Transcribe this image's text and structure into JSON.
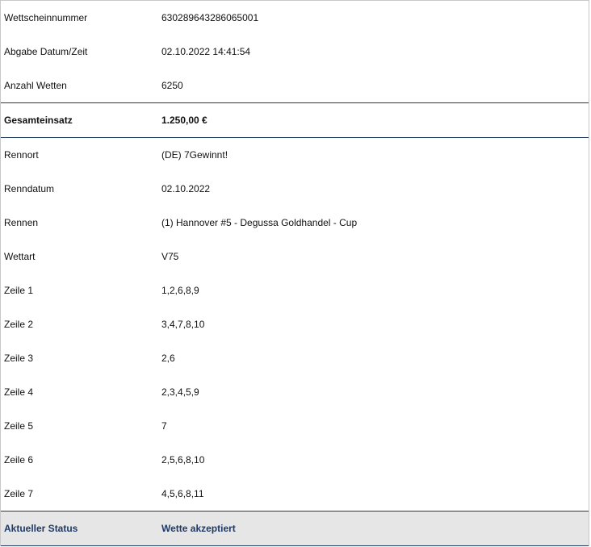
{
  "header_rows": [
    {
      "label": "Wettscheinnummer",
      "value": "630289643286065001"
    },
    {
      "label": "Abgabe Datum/Zeit",
      "value": "02.10.2022 14:41:54"
    },
    {
      "label": "Anzahl Wetten",
      "value": "6250"
    }
  ],
  "total": {
    "label": "Gesamteinsatz",
    "value": "1.250,00 €"
  },
  "detail_rows": [
    {
      "label": "Rennort",
      "value": "(DE) 7Gewinnt!"
    },
    {
      "label": "Renndatum",
      "value": "02.10.2022"
    },
    {
      "label": "Rennen",
      "value": "(1) Hannover #5 - Degussa Goldhandel - Cup"
    },
    {
      "label": "Wettart",
      "value": "V75"
    },
    {
      "label": "Zeile 1",
      "value": "1,2,6,8,9"
    },
    {
      "label": "Zeile 2",
      "value": "3,4,7,8,10"
    },
    {
      "label": "Zeile 3",
      "value": "2,6"
    },
    {
      "label": "Zeile 4",
      "value": "2,3,4,5,9"
    },
    {
      "label": "Zeile 5",
      "value": "7"
    },
    {
      "label": "Zeile 6",
      "value": "2,5,6,8,10"
    },
    {
      "label": "Zeile 7",
      "value": "4,5,6,8,11"
    }
  ],
  "status": {
    "label": "Aktueller Status",
    "value": "Wette akzeptiert"
  }
}
